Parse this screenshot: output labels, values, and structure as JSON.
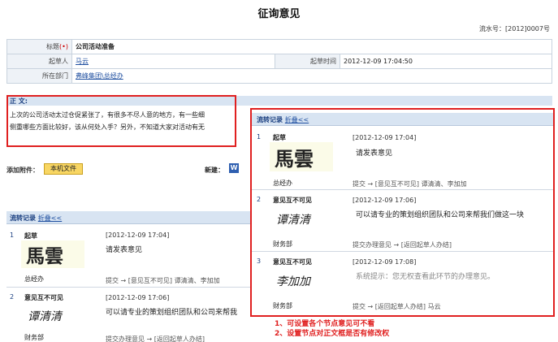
{
  "page": {
    "title": "征询意见",
    "serial": "流水号：[2012]0007号"
  },
  "form": {
    "title_label": "标题",
    "title_required": "(•)",
    "title_value": "公司活动准备",
    "drafter_label": "起草人",
    "drafter_value": "马云",
    "draft_time_label": "起草时间",
    "draft_time_value": "2012-12-09 17:04:50",
    "dept_label": "所在部门",
    "dept_value": "弗峰集团\\总经办"
  },
  "body": {
    "label": "正    文:",
    "line1": "上次的公司活动太过仓促紧张了，有很多不尽人意的地方，有一些细",
    "line2": "侧重哪些方面比较好，该从何处入手？另外，不知道大家对活动有无"
  },
  "attachments": {
    "label": "添加附件：",
    "local_button": "本机文件",
    "new_label": "新建：",
    "word_icon": "W"
  },
  "flow_left": {
    "title": "流转记录",
    "fold": "折叠<<",
    "steps": [
      {
        "num": "1",
        "name": "起草",
        "time": "[2012-12-09 17:04]",
        "msg": "请发表意见",
        "dept": "总经办",
        "route": "提交 → [意见互不可见] 谭清清、李加加",
        "signature": "馬雲"
      },
      {
        "num": "2",
        "name": "意见互不可见",
        "time": "[2012-12-09 17:06]",
        "msg": "可以请专业的策划组织团队和公司来帮我",
        "dept": "财务部",
        "route": "提交办理意见 → [返回起草人办结]",
        "signature": "谭清清"
      }
    ]
  },
  "flow_right": {
    "title": "流转记录",
    "fold": "折叠<<",
    "steps": [
      {
        "num": "1",
        "name": "起草",
        "time": "[2012-12-09 17:04]",
        "msg": "请发表意见",
        "dept": "总经办",
        "route": "提交 → [意见互不可见] 谭清清、李加加",
        "signature": "馬雲"
      },
      {
        "num": "2",
        "name": "意见互不可见",
        "time": "[2012-12-09 17:06]",
        "msg": "可以请专业的策划组织团队和公司来帮我们做这一块",
        "dept": "财务部",
        "route": "提交办理意见 → [返回起草人办结]",
        "signature": "谭清清"
      },
      {
        "num": "3",
        "name": "意见互不可见",
        "time": "[2012-12-09 17:08]",
        "msg": "系统提示：您无权查看此环节的办理意见。",
        "dept": "财务部",
        "route": "提交 → [返回起草人办结] 马云",
        "signature": "李加加"
      }
    ]
  },
  "notes": {
    "line1": "1、可设置各个节点意见可不看",
    "line2": "2、设置节点对正文框是否有修改权"
  },
  "colors": {
    "highlight": "#e02020",
    "header_bg": "#d8e4f2",
    "link": "#1f4fa0"
  }
}
